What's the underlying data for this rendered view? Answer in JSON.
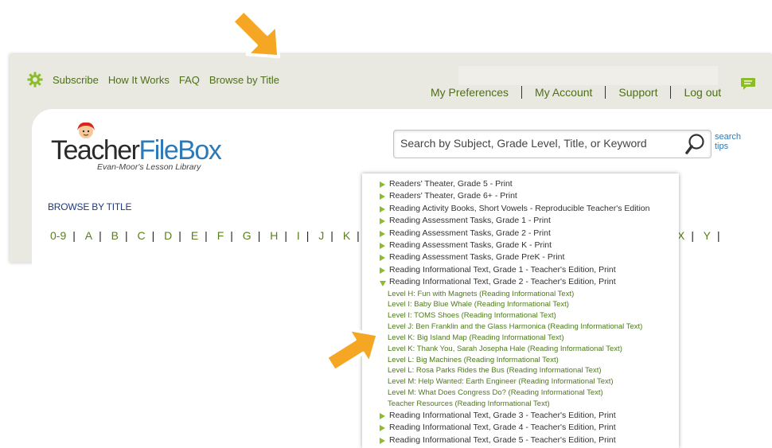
{
  "topnav": {
    "icon": "gear-icon",
    "links": [
      "Subscribe",
      "How It Works",
      "FAQ",
      "Browse by Title"
    ]
  },
  "account_nav": {
    "links": [
      "My Preferences",
      "My Account",
      "Support",
      "Log out"
    ]
  },
  "logo": {
    "word_part1": "Teacher",
    "word_part2": "FileBox",
    "tagline": "Evan-Moor's Lesson Library"
  },
  "search": {
    "placeholder": "Search by Subject, Grade Level, Title, or Keyword",
    "tips_line1": "search",
    "tips_line2": "tips"
  },
  "browse": {
    "heading": "BROWSE BY TITLE",
    "letters_left": [
      "0-9",
      "A",
      "B",
      "C",
      "D",
      "E",
      "F",
      "G",
      "H",
      "I",
      "J",
      "K"
    ],
    "letters_right": [
      "X",
      "Y"
    ]
  },
  "dropdown": {
    "items_before": [
      "Readers' Theater, Grade 5 - Print",
      "Readers' Theater, Grade 6+ - Print",
      "Reading Activity Books, Short Vowels - Reproducible Teacher's Edition",
      "Reading Assessment Tasks, Grade 1 - Print",
      "Reading Assessment Tasks, Grade 2 - Print",
      "Reading Assessment Tasks, Grade K - Print",
      "Reading Assessment Tasks, Grade PreK - Print",
      "Reading Informational Text, Grade 1 - Teacher's Edition, Print"
    ],
    "expanded_item": "Reading Informational Text, Grade 2 - Teacher's Edition, Print",
    "sub_items": [
      "Level H: Fun with Magnets (Reading Informational Text)",
      "Level I: Baby Blue Whale (Reading Informational Text)",
      "Level I: TOMS Shoes (Reading Informational Text)",
      "Level J: Ben Franklin and the Glass Harmonica (Reading Informational Text)",
      "Level K: Big Island Map (Reading Informational Text)",
      "Level K: Thank You, Sarah Josepha Hale (Reading Informational Text)",
      "Level L: Big Machines (Reading Informational Text)",
      "Level L: Rosa Parks Rides the Bus (Reading Informational Text)",
      "Level M: Help Wanted: Earth Engineer (Reading Informational Text)",
      "Level M: What Does Congress Do? (Reading Informational Text)",
      "Teacher Resources (Reading Informational Text)"
    ],
    "items_after": [
      "Reading Informational Text, Grade 3 - Teacher's Edition, Print",
      "Reading Informational Text, Grade 4 - Teacher's Edition, Print",
      "Reading Informational Text, Grade 5 - Teacher's Edition, Print"
    ]
  },
  "colors": {
    "nav_green": "#4d6f19",
    "bullet_green": "#8bbd2a",
    "arrow_orange": "#f5a623",
    "logo_blue": "#2e7ab8"
  }
}
